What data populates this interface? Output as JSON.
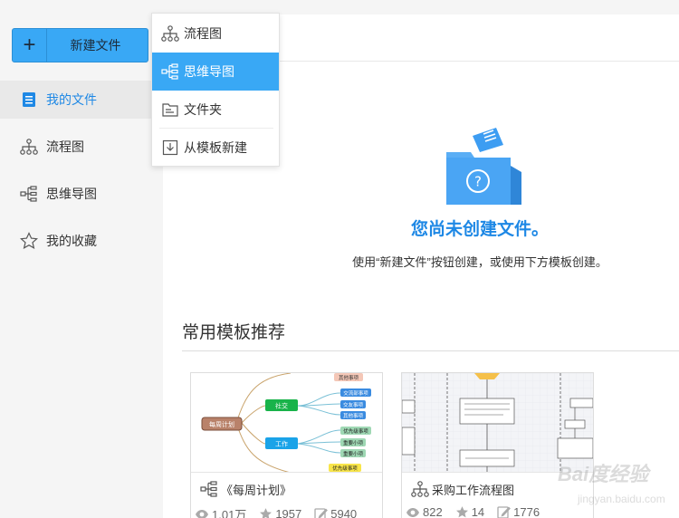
{
  "sidebar": {
    "new_button_label": "新建文件",
    "items": [
      {
        "label": "我的文件",
        "icon": "document-icon",
        "active": true
      },
      {
        "label": "流程图",
        "icon": "flowchart-icon"
      },
      {
        "label": "思维导图",
        "icon": "mindmap-icon"
      },
      {
        "label": "我的收藏",
        "icon": "star-icon"
      }
    ]
  },
  "dropdown": {
    "items": [
      {
        "label": "流程图",
        "icon": "flowchart-icon"
      },
      {
        "label": "思维导图",
        "icon": "mindmap-icon",
        "active": true
      },
      {
        "label": "文件夹",
        "icon": "folder-icon"
      },
      {
        "label": "从模板新建",
        "icon": "template-import-icon"
      }
    ]
  },
  "empty_state": {
    "icon": "empty-folder-question-icon",
    "title": "您尚未创建文件。",
    "description": "使用“新建文件”按钮创建，或使用下方模板创建。"
  },
  "templates": {
    "section_title": "常用模板推荐",
    "cards": [
      {
        "name": "《每周计划》",
        "icon": "mindmap-icon",
        "views": "1.01万",
        "stars": "1957",
        "edits": "5940",
        "thumb": {
          "center": "每周计划",
          "branch_1": "社交",
          "branch_2": "工作",
          "leaf_top": "其他事项",
          "leaf_1": "交流部事项",
          "leaf_2": "交友事项",
          "leaf_3": "其他事项",
          "leaf_4": "优先级事项",
          "leaf_5": "重要小项",
          "leaf_6": "重要小项",
          "leaf_bottom": "优先级事项"
        }
      },
      {
        "name": "采购工作流程图",
        "icon": "flowchart-icon",
        "views": "822",
        "stars": "14",
        "edits": "1776"
      }
    ]
  },
  "watermark": {
    "text": "Bai度经验",
    "url": "jingyan.baidu.com"
  },
  "colors": {
    "accent": "#39a8f5",
    "title_blue": "#1e88e5",
    "sidebar_bg": "#f5f5f5"
  }
}
